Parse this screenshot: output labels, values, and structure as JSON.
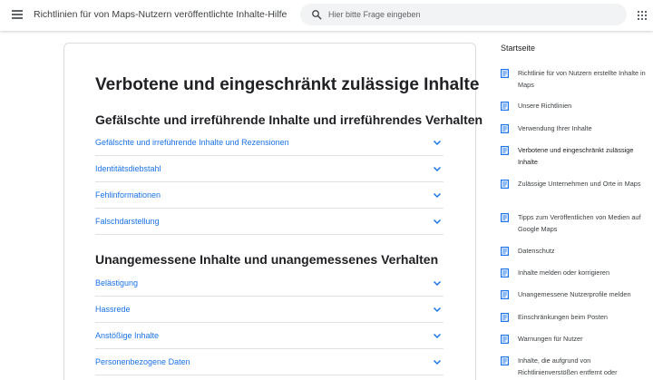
{
  "header": {
    "title": "Richtlinien für von Maps-Nutzern veröffentlichte Inhalte-Hilfe",
    "search_placeholder": "Hier bitte Frage eingeben"
  },
  "main": {
    "title": "Verbotene und eingeschränkt zulässige Inhalte",
    "sections": [
      {
        "title": "Gefälschte und irreführende Inhalte und irreführendes Verhalten",
        "items": [
          "Gefälschte und irreführende Inhalte und Rezensionen",
          "Identitätsdiebstahl",
          "Fehlinformationen",
          "Falschdarstellung"
        ]
      },
      {
        "title": "Unangemessene Inhalte und unangemessenes Verhalten",
        "items": [
          "Belästigung",
          "Hassrede",
          "Anstößige Inhalte",
          "Personenbezogene Daten"
        ]
      }
    ]
  },
  "sidebar": {
    "home": "Startseite",
    "items": [
      "Richtlinie für von Nutzern erstellte Inhalte in Maps",
      "Unsere Richtlinien",
      "Verwendung Ihrer Inhalte",
      "Verbotene und eingeschränkt zulässige Inhalte",
      "Zulässige Unternehmen und Orte in Maps",
      "Tipps zum Veröffentlichen von Medien auf Google Maps",
      "Datenschutz",
      "Inhalte melden oder korrigieren",
      "Unangemessene Nutzerprofile melden",
      "Einschränkungen beim Posten",
      "Warnungen für Nutzer",
      "Inhalte, die aufgrund von Richtlinienverstößen entfernt oder"
    ]
  },
  "icons": {
    "menu": "hamburger-menu-icon",
    "search": "search-icon",
    "apps": "apps-grid-icon",
    "expand": "chevron-down-icon",
    "doc": "document-icon"
  },
  "colors": {
    "link": "#1a73e8",
    "text": "#202124",
    "search_bg": "#f1f3f4"
  }
}
